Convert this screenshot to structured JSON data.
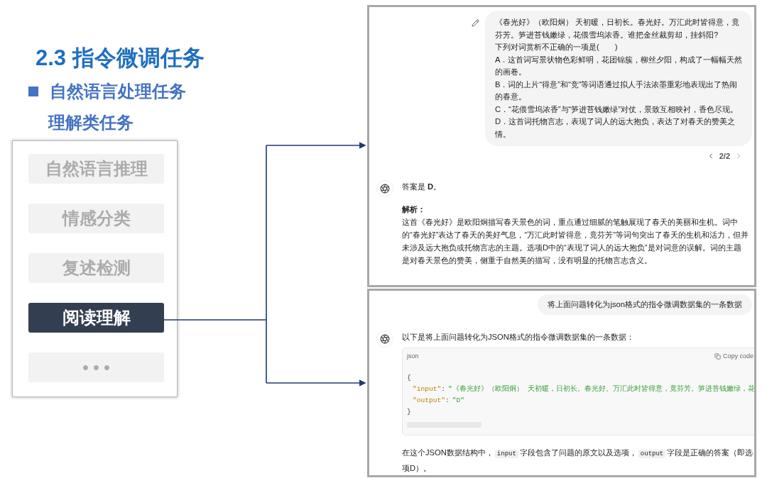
{
  "slide": {
    "title": "2.3 指令微调任务",
    "bullet": "自然语言处理任务",
    "subheading": "理解类任务"
  },
  "task_menu": [
    {
      "label": "自然语言推理",
      "selected": false
    },
    {
      "label": "情感分类",
      "selected": false
    },
    {
      "label": "复述检测",
      "selected": false
    },
    {
      "label": "阅读理解",
      "selected": true
    },
    {
      "label": "• • •",
      "selected": false
    }
  ],
  "chat_top": {
    "user_message": [
      "《春光好》（欧阳炯） 天初暖，日初长。春光好。万汇此时皆得意，竟芬芳。笋进苔钱嫩绿，花偎雪坞浓香。谁把金丝裁剪却，挂斜阳?",
      "下列对词赏析不正确的一项是(　　)",
      "A．这首词写景状物色彩鲜明，花团锦簇，柳丝夕阳，构成了一幅幅天然的画卷。",
      "B．词的上片“得意”和“竞”等词语通过拟人手法浓墨重彩地表现出了热闹的春意。",
      "C．“花偎雪坞浓香”与“笋进苔钱嫩绿”对仗，景致互相映衬，香色尽现。",
      "D．这首词托物言志，表现了词人的远大抱负，表达了对春天的赞美之情。"
    ],
    "pager": "2/2",
    "answer": "答案是 **D**。",
    "analysis_heading": "解析：",
    "analysis": "这首《春光好》是欧阳炯描写春天景色的词，重点通过细腻的笔触展现了春天的美丽和生机。词中的“春光好”表达了春天的美好气息，“万汇此时皆得意，竟芬芳”等词句突出了春天的生机和活力，但并未涉及远大抱负或托物言志的主题。选项D中的“表现了词人的远大抱负”是对词意的误解。词的主题是对春天景色的赞美，侧重于自然美的描写，没有明显的托物言志含义。"
  },
  "chat_bottom": {
    "user_message": "将上面问题转化为json格式的指令微调数据集的一条数据",
    "assistant_intro": "以下是将上面问题转化为JSON格式的指令微调数据集的一条数据：",
    "code_block": {
      "language": "json",
      "copy_label": "Copy code",
      "open": "{",
      "close": "}",
      "entries": [
        {
          "key": "\"input\"",
          "separator": ":",
          "value": "\"《春光好》（欧阳炯） 天初暖，日初长。春光好。万汇此时皆得意，竟芬芳。笋进苔钱嫩绿，花"
        },
        {
          "key": "\"output\"",
          "separator": ":",
          "value": "\"D\""
        }
      ]
    },
    "explanation": [
      {
        "kind": "text",
        "text": "在这个JSON数据结构中，"
      },
      {
        "kind": "code",
        "text": "input"
      },
      {
        "kind": "text",
        "text": "字段包含了问题的原文以及选项，"
      },
      {
        "kind": "code",
        "text": "output"
      },
      {
        "kind": "text",
        "text": "字段是正确的答案（即选项D）。"
      }
    ]
  }
}
